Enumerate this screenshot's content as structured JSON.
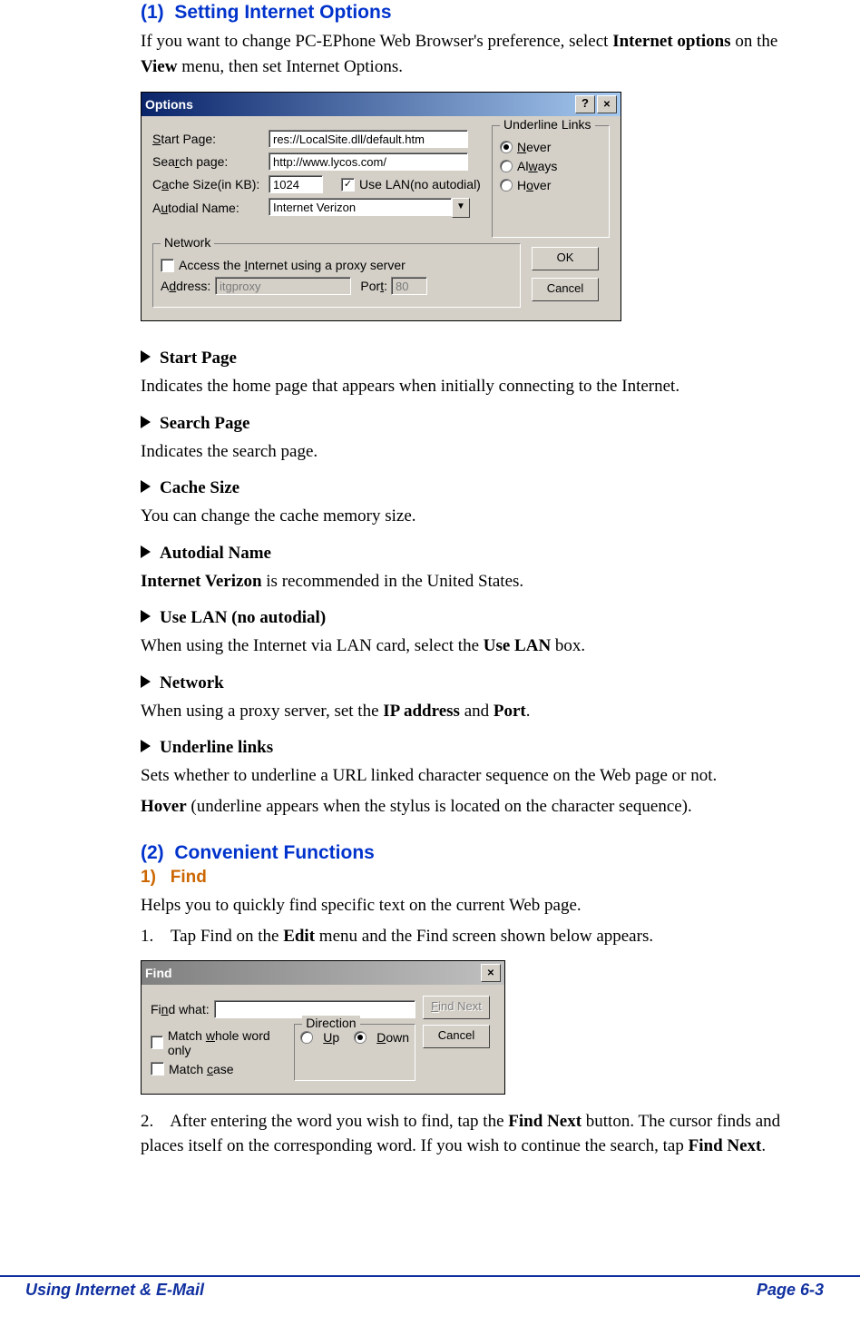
{
  "section1": {
    "heading": "(1)  Setting Internet Options",
    "intro_a": "If you want to change PC-EPhone Web Browser's preference, select ",
    "intro_bold_a": "Internet options",
    "intro_b": " on the ",
    "intro_bold_b": "View",
    "intro_c": " menu, then set Internet Options."
  },
  "options_dialog": {
    "title": "Options",
    "help_btn": "?",
    "labels": {
      "start_page": "Start Page:",
      "search_page": "Search page:",
      "cache_size": "Cache Size(in KB):",
      "autodial": "Autodial Name:"
    },
    "values": {
      "start_page": "res://LocalSite.dll/default.htm",
      "search_page": "http://www.lycos.com/",
      "cache_size": "1024",
      "autodial": "Internet Verizon"
    },
    "use_lan": "Use LAN(no autodial)",
    "underline_group": "Underline Links",
    "underline": {
      "never": "Never",
      "always": "Always",
      "hover": "Hover"
    },
    "network_group": "Network",
    "proxy_label": "Access the Internet using a proxy server",
    "address_label": "Address:",
    "address_value": "itgproxy",
    "port_label": "Port:",
    "port_value": "80",
    "ok": "OK",
    "cancel": "Cancel"
  },
  "items": {
    "start_page": {
      "title": "Start Page",
      "body": "Indicates the home page that appears when initially connecting to the Internet."
    },
    "search_page": {
      "title": "Search Page",
      "body": "Indicates the search page."
    },
    "cache_size": {
      "title": "Cache Size",
      "body": "You can change the cache memory size."
    },
    "autodial": {
      "title": "Autodial Name",
      "bold": "Internet Verizon",
      "body": " is recommended in the United States."
    },
    "use_lan": {
      "title": "Use LAN (no autodial)",
      "pre": "When using the Internet via LAN card, select the ",
      "bold": "Use LAN",
      "post": " box."
    },
    "network": {
      "title": "Network",
      "pre": "When using a proxy server, set the ",
      "bold1": "IP address",
      "mid": " and ",
      "bold2": "Port",
      "post": "."
    },
    "underline": {
      "title": "Underline links",
      "body": "Sets whether to underline a URL linked character sequence on the Web page or not.",
      "bold": "Hover",
      "post": " (underline appears when the stylus is located on the character sequence)."
    }
  },
  "section2": {
    "heading": "(2)  Convenient Functions",
    "sub1": "1)   Find",
    "intro": "Helps you to quickly find specific text on the current Web page.",
    "step1_a": "1.    Tap Find on the ",
    "step1_bold": "Edit",
    "step1_b": " menu and the Find screen shown below appears."
  },
  "find_dialog": {
    "title": "Find",
    "find_what": "Find what:",
    "match_whole": "Match whole word only",
    "match_case": "Match case",
    "direction": "Direction",
    "up": "Up",
    "down": "Down",
    "find_next": "Find Next",
    "cancel": "Cancel"
  },
  "after_find": {
    "a": "2.    After entering the word you wish to find, tap the ",
    "b1": "Find Next",
    "c": " button. The cursor finds and places itself on the corresponding word. If you wish to continue the search, tap ",
    "b2": "Find Next",
    "d": "."
  },
  "footer": {
    "left": "Using Internet & E-Mail",
    "right": "Page 6-3"
  }
}
